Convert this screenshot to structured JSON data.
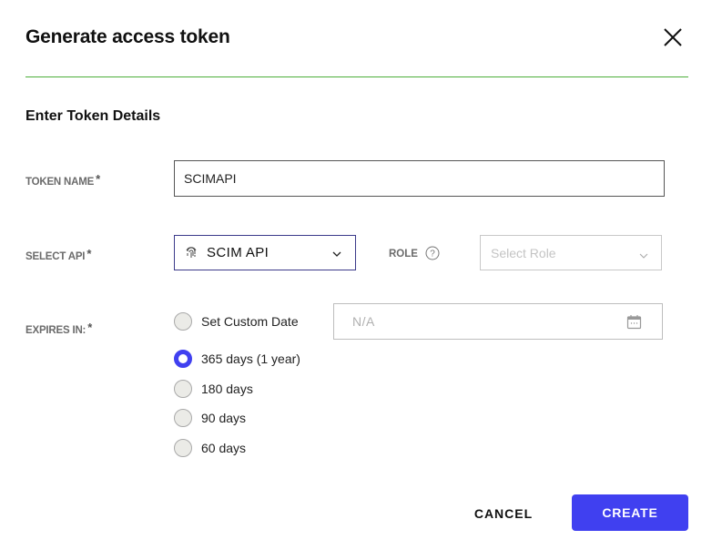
{
  "dialog": {
    "title": "Generate access token",
    "section_title": "Enter Token Details",
    "accent_color": "#4040f0",
    "divider_color": "#4caf3a"
  },
  "fields": {
    "token_name": {
      "label": "TOKEN NAME",
      "required_mark": "*",
      "value": "SCIMAPI"
    },
    "select_api": {
      "label": "SELECT API",
      "required_mark": "*",
      "value": "SCIM API",
      "icon": "fingerprint-icon"
    },
    "role": {
      "label": "ROLE",
      "help_icon": "question-circle-icon",
      "placeholder": "Select Role"
    },
    "expires_in": {
      "label": "EXPIRES IN:",
      "required_mark": "*",
      "custom_date_placeholder": "N/A",
      "options": [
        {
          "label": "Set Custom Date",
          "selected": false
        },
        {
          "label": "365 days (1 year)",
          "selected": true
        },
        {
          "label": "180 days",
          "selected": false
        },
        {
          "label": "90 days",
          "selected": false
        },
        {
          "label": "60 days",
          "selected": false
        }
      ]
    }
  },
  "actions": {
    "cancel": "CANCEL",
    "create": "CREATE"
  }
}
